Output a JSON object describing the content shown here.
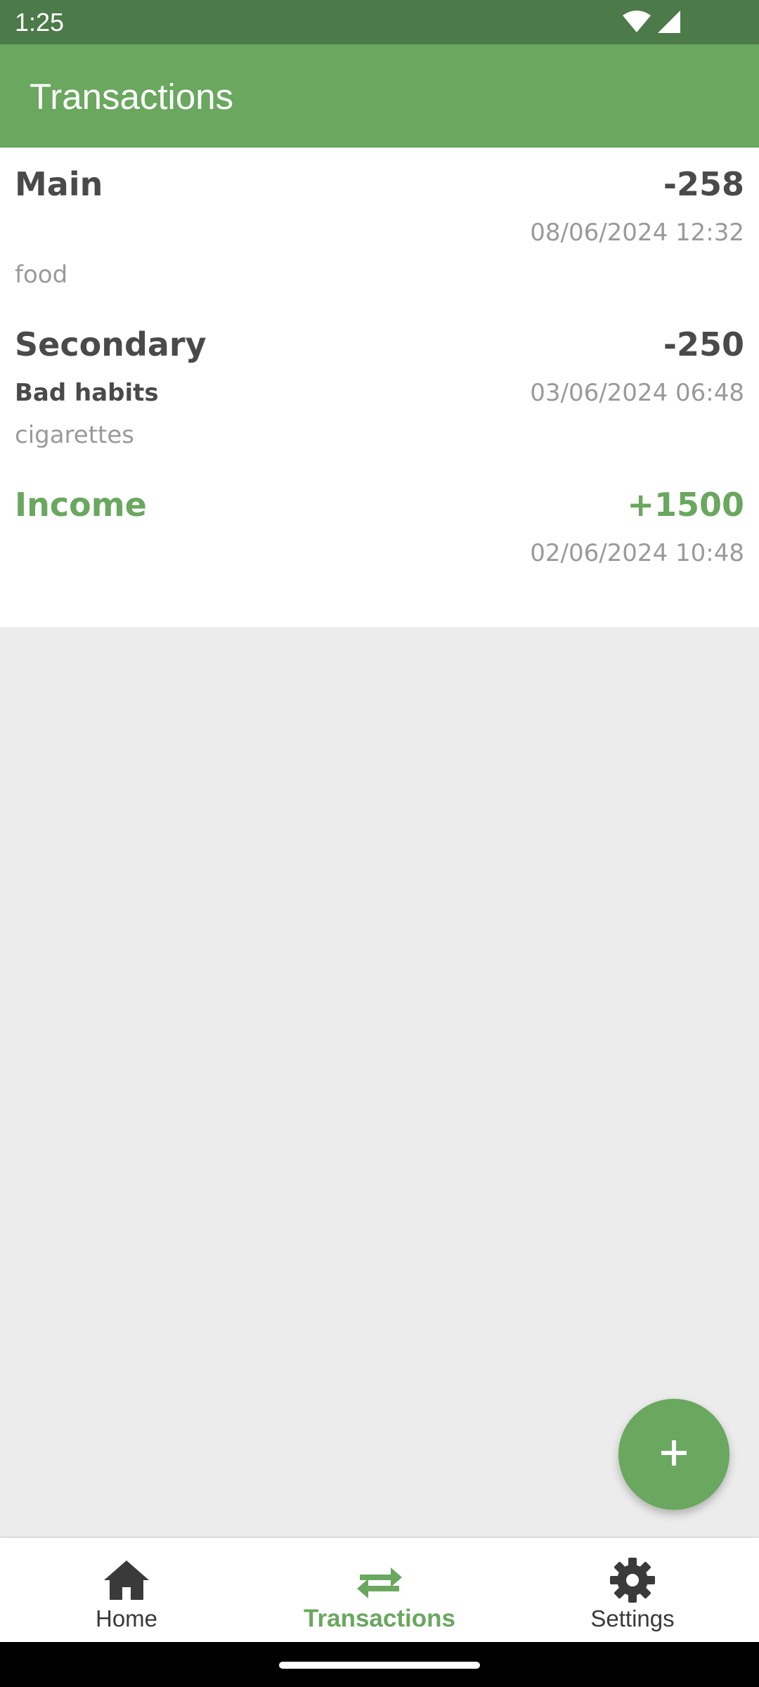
{
  "status_bar": {
    "time": "1:25",
    "icons": [
      "wifi-icon",
      "cell-signal-icon"
    ]
  },
  "app_bar": {
    "title": "Transactions"
  },
  "transactions": [
    {
      "account": "Main",
      "amount": "-258",
      "category": "",
      "date": "08/06/2024 12:32",
      "note": "food",
      "type": "expense"
    },
    {
      "account": "Secondary",
      "amount": "-250",
      "category": "Bad habits",
      "date": "03/06/2024 06:48",
      "note": "cigarettes",
      "type": "expense"
    },
    {
      "account": "Income",
      "amount": "+1500",
      "category": "",
      "date": "02/06/2024 10:48",
      "note": "",
      "type": "income"
    }
  ],
  "fab": {
    "icon": "plus-icon"
  },
  "bottom_nav": {
    "items": [
      {
        "label": "Home",
        "icon": "home-icon",
        "active": false
      },
      {
        "label": "Transactions",
        "icon": "transfer-arrows-icon",
        "active": true
      },
      {
        "label": "Settings",
        "icon": "gear-icon",
        "active": false
      }
    ]
  },
  "colors": {
    "primary": "#6aa75f",
    "status_bar": "#4c7a49",
    "text_dark": "#4a4a4a",
    "text_muted": "#9a9a9a",
    "background": "#ececec"
  }
}
